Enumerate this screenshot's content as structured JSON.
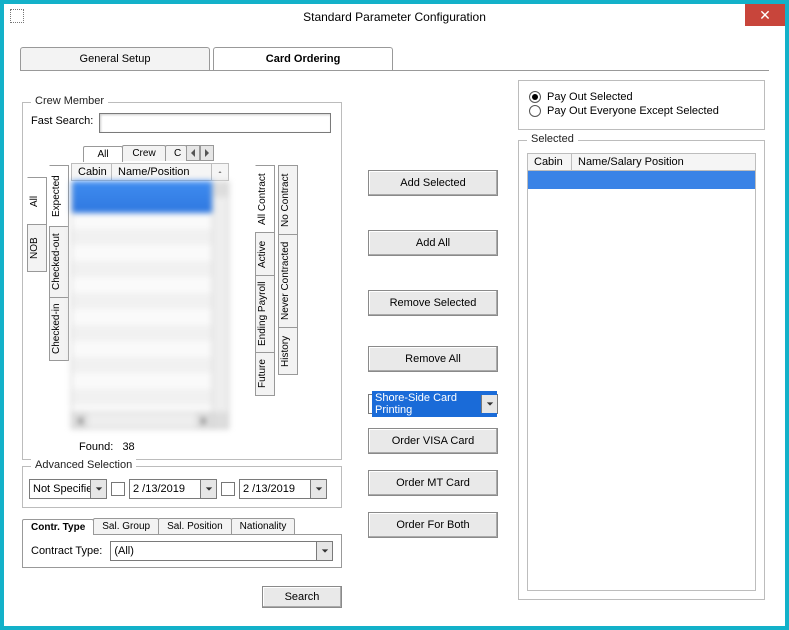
{
  "window": {
    "title": "Standard Parameter Configuration",
    "close_glyph": "✕"
  },
  "tabs": {
    "general": "General Setup",
    "card_ordering": "Card Ordering"
  },
  "payout": {
    "group_title": "",
    "option_selected": "Pay Out Selected",
    "option_except": "Pay Out Everyone Except Selected"
  },
  "crew": {
    "group_title": "Crew Member",
    "fast_search_label": "Fast Search:",
    "fast_search_value": "",
    "cat_tabs": {
      "all": "All",
      "crew": "Crew",
      "c": "C"
    },
    "left_tabs": {
      "all": "All",
      "nob": "NOB"
    },
    "status_tabs": {
      "expected": "Expected",
      "checked_out": "Checked-out",
      "checked_in": "Checked-in"
    },
    "right_tabs": {
      "all_contract": "All Contract",
      "no_contract": "No Contract",
      "active": "Active",
      "never_contracted": "Never Contracted",
      "ending_payroll": "Ending Payroll",
      "future": "Future",
      "history": "History"
    },
    "list": {
      "col_cabin": "Cabin",
      "col_namepos": "Name/Position"
    },
    "found_label": "Found:",
    "found_value": "38"
  },
  "adv": {
    "group_title": "Advanced Selection",
    "not_specified": "Not Specifiec",
    "date1": "2 /13/2019",
    "date2": "2 /13/2019"
  },
  "filter": {
    "tabs": {
      "contr_type": "Contr. Type",
      "sal_group": "Sal. Group",
      "sal_position": "Sal. Position",
      "nationality": "Nationality"
    },
    "contract_type_label": "Contract Type:",
    "contract_type_value": "(All)",
    "search_btn": "Search"
  },
  "actions": {
    "add_selected": "Add Selected",
    "add_all": "Add All",
    "remove_selected": "Remove Selected",
    "remove_all": "Remove All",
    "card_printing": "Shore-Side Card Printing",
    "order_visa": "Order VISA Card",
    "order_mt": "Order MT Card",
    "order_both": "Order For Both"
  },
  "selected": {
    "group_title": "Selected",
    "col_cabin": "Cabin",
    "col_namepos": "Name/Salary Position"
  }
}
